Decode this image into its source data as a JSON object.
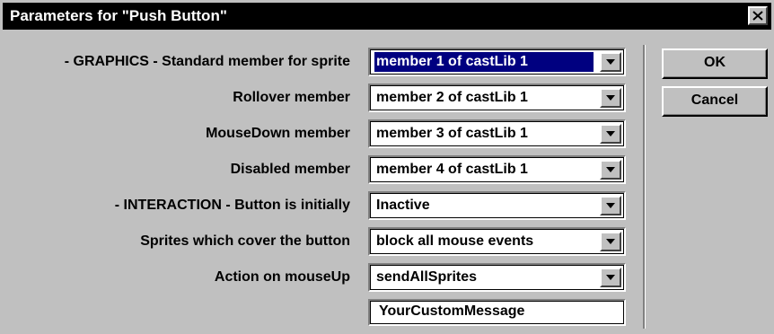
{
  "window": {
    "title": "Parameters for \"Push Button\""
  },
  "params": [
    {
      "label": "- GRAPHICS - Standard member for sprite",
      "value": "member 1 of castLib 1",
      "selected": true
    },
    {
      "label": "Rollover member",
      "value": "member 2 of castLib 1"
    },
    {
      "label": "MouseDown member",
      "value": "member 3 of castLib 1"
    },
    {
      "label": "Disabled member",
      "value": "member 4 of castLib 1"
    },
    {
      "label": "- INTERACTION - Button is initially",
      "value": "Inactive"
    },
    {
      "label": "Sprites which cover the button",
      "value": "block all mouse events"
    },
    {
      "label": "Action on mouseUp",
      "value": "sendAllSprites"
    }
  ],
  "custom_message": {
    "value": "YourCustomMessage"
  },
  "buttons": {
    "ok_label": "OK",
    "cancel_label": "Cancel"
  },
  "colors": {
    "titlebar": "#000000",
    "dialog": "#c0c0c0",
    "selection": "#000080"
  },
  "icons": {
    "close": "close-icon",
    "dropdown": "chevron-down-icon"
  }
}
